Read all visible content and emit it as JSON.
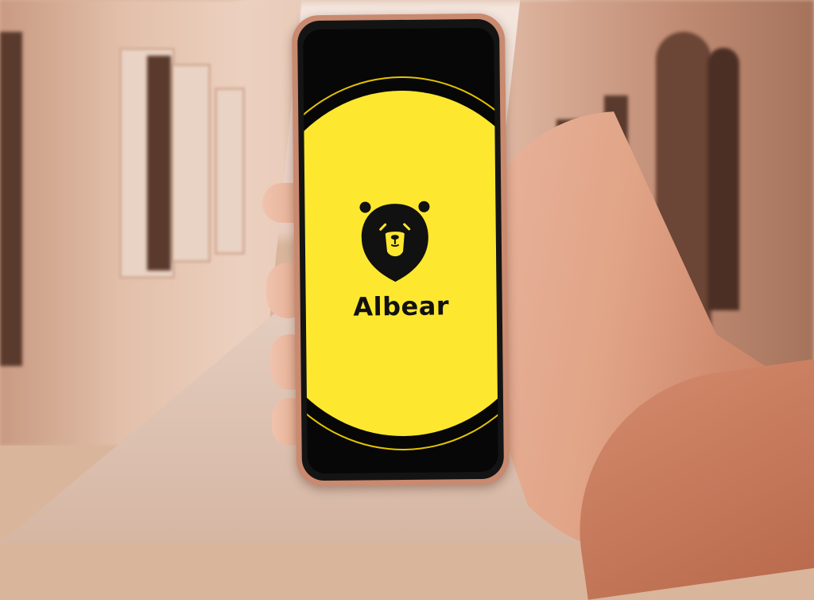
{
  "app": {
    "name": "Albear",
    "logo_icon": "bear-head-icon",
    "background_color": "#070707",
    "accent_color": "#fde82f"
  }
}
